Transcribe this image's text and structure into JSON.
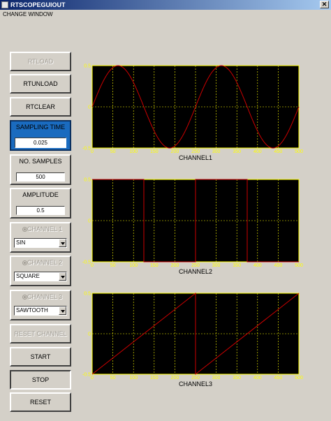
{
  "window": {
    "title": "RTSCOPEGUIOUT",
    "close_glyph": "✕"
  },
  "menu": {
    "change_window": "CHANGE WINDOW"
  },
  "buttons": {
    "rtload": "RTLOAD",
    "rtunload": "RTUNLOAD",
    "rtclear": "RTCLEAR",
    "reset_channel": "RESET CHANNEL",
    "start": "START",
    "stop": "STOP",
    "reset": "RESET"
  },
  "sampling_time": {
    "label": "SAMPLING TIME",
    "value": "0.025"
  },
  "no_samples": {
    "label": "NO. SAMPLES",
    "value": "500"
  },
  "amplitude": {
    "label": "AMPLITUDE",
    "value": "0.5"
  },
  "channels": [
    {
      "label": "CHANNEL 1",
      "waveform": "SIN"
    },
    {
      "label": "CHANNEL 2",
      "waveform": "SQUARE"
    },
    {
      "label": "CHANNEL 3",
      "waveform": "SAWTOOTH"
    }
  ],
  "colors": {
    "plot_bg": "#000000",
    "axis": "#ffff00",
    "grid": "#ffff00",
    "trace": "#cc0000",
    "selected_panel": "#1a6bbf"
  },
  "chart_data": [
    {
      "type": "line",
      "xlabel": "CHANNEL1",
      "xlim": [
        0,
        500
      ],
      "ylim": [
        -0.5,
        0.5
      ],
      "xticks": [
        "0",
        "50",
        "100",
        "150",
        "200",
        "250",
        "300",
        "350",
        "400",
        "450",
        "500"
      ],
      "yticks": [
        "-0.5",
        "0",
        "0.5"
      ],
      "grid": true,
      "series": [
        {
          "waveform": "sine",
          "amplitude": 0.5,
          "period": 250,
          "x": [
            0,
            62.5,
            125,
            187.5,
            250,
            312.5,
            375,
            437.5,
            500
          ],
          "values": [
            0,
            0.5,
            0,
            -0.5,
            0,
            0.5,
            0,
            -0.5,
            0
          ]
        }
      ]
    },
    {
      "type": "line",
      "xlabel": "CHANNEL2",
      "xlim": [
        0,
        500
      ],
      "ylim": [
        -0.5,
        0.5
      ],
      "xticks": [
        "0",
        "50",
        "100",
        "150",
        "200",
        "250",
        "300",
        "350",
        "400",
        "450",
        "500"
      ],
      "yticks": [
        "-0.5",
        "0",
        "0.5"
      ],
      "grid": true,
      "series": [
        {
          "waveform": "square",
          "amplitude": 0.5,
          "period": 250,
          "x": [
            0,
            125,
            125,
            250,
            250,
            375,
            375,
            500
          ],
          "values": [
            0.5,
            0.5,
            -0.5,
            -0.5,
            0.5,
            0.5,
            -0.5,
            -0.5
          ]
        }
      ]
    },
    {
      "type": "line",
      "xlabel": "CHANNEL3",
      "xlim": [
        0,
        500
      ],
      "ylim": [
        -0.5,
        0.5
      ],
      "xticks": [
        "0",
        "50",
        "100",
        "150",
        "200",
        "250",
        "300",
        "350",
        "400",
        "450",
        "500"
      ],
      "yticks": [
        "-0.5",
        "0",
        "0.5"
      ],
      "grid": true,
      "series": [
        {
          "waveform": "sawtooth",
          "amplitude": 0.5,
          "period": 250,
          "x": [
            0,
            250,
            250,
            500
          ],
          "values": [
            -0.5,
            0.5,
            -0.5,
            0.5
          ]
        }
      ]
    }
  ]
}
